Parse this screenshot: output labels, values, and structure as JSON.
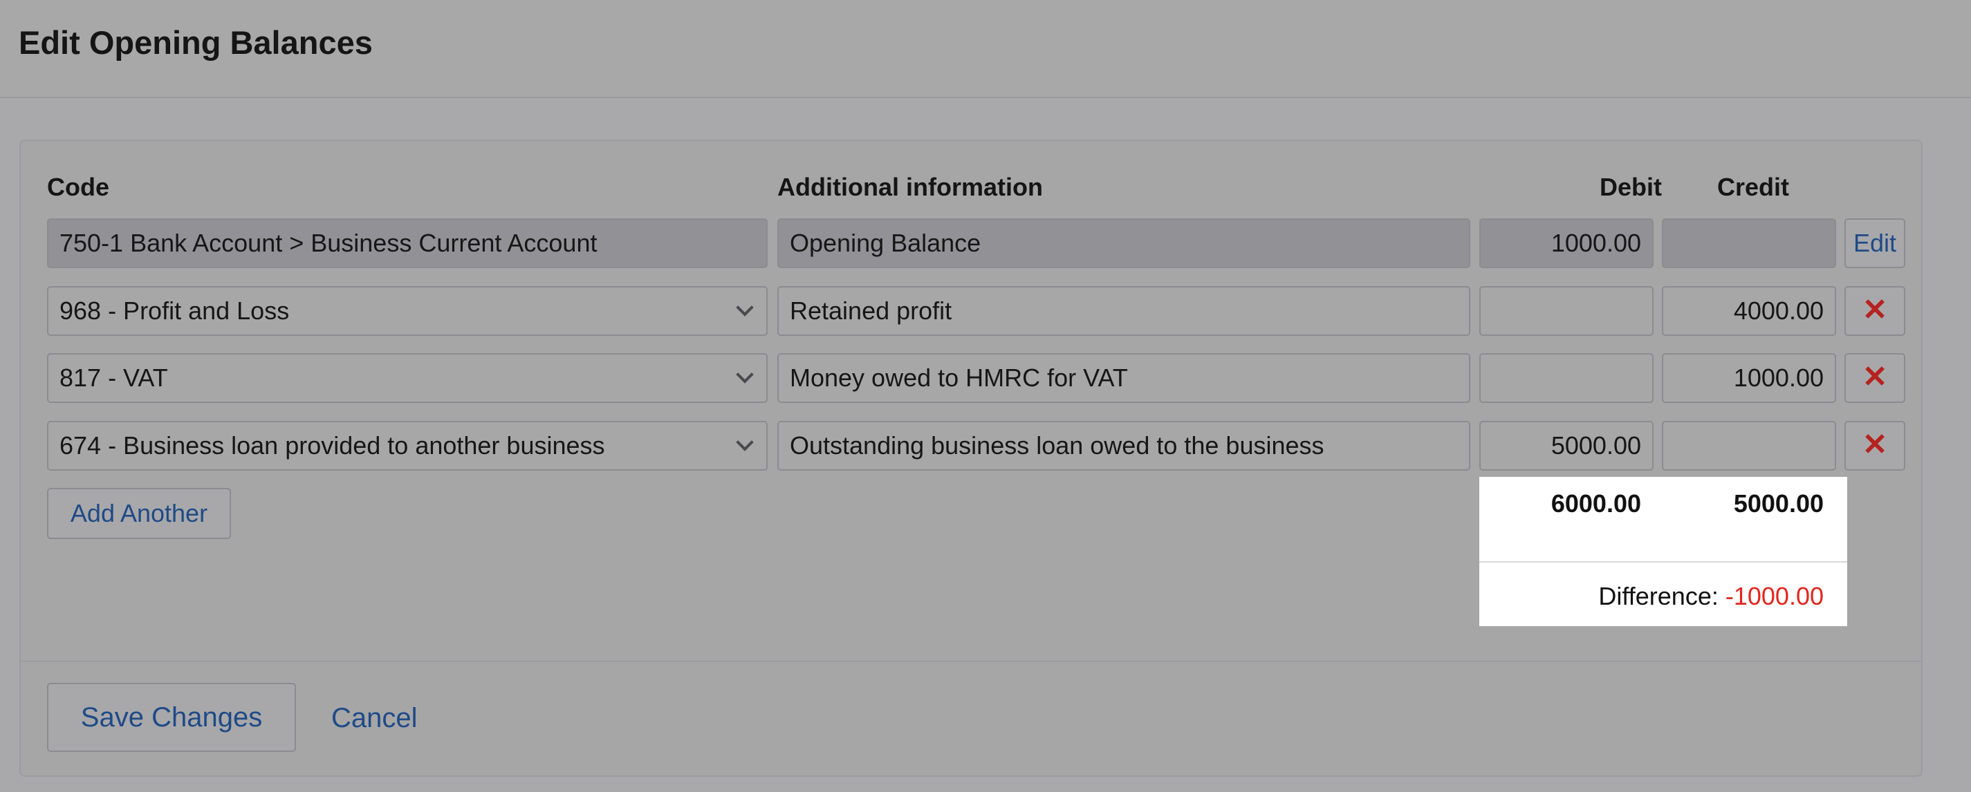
{
  "page": {
    "title": "Edit Opening Balances"
  },
  "table": {
    "headers": {
      "code": "Code",
      "info": "Additional information",
      "debit": "Debit",
      "credit": "Credit"
    },
    "rows": [
      {
        "code": "750-1 Bank Account  >  Business Current Account",
        "info": "Opening Balance",
        "debit": "1000.00",
        "credit": "",
        "locked": true,
        "action": "Edit"
      },
      {
        "code": "968 - Profit and Loss",
        "info": "Retained profit",
        "debit": "",
        "credit": "4000.00",
        "locked": false,
        "action": "✕"
      },
      {
        "code": "817 - VAT",
        "info": "Money owed to HMRC for VAT",
        "debit": "",
        "credit": "1000.00",
        "locked": false,
        "action": "✕"
      },
      {
        "code": "674 - Business loan provided to another business",
        "info": "Outstanding business loan owed to the business",
        "debit": "5000.00",
        "credit": "",
        "locked": false,
        "action": "✕"
      }
    ],
    "add_label": "Add Another"
  },
  "totals": {
    "debit": "6000.00",
    "credit": "5000.00",
    "difference_label": "Difference:",
    "difference_value": "-1000.00"
  },
  "footer": {
    "save_label": "Save Changes",
    "cancel_label": "Cancel"
  },
  "colors": {
    "accent": "#1f4a87",
    "danger": "#b5231f",
    "difference": "#e3261e",
    "overlay": "#a9a9ab"
  },
  "icons": {
    "remove": "close-icon",
    "dropdown": "chevron-down-icon"
  }
}
